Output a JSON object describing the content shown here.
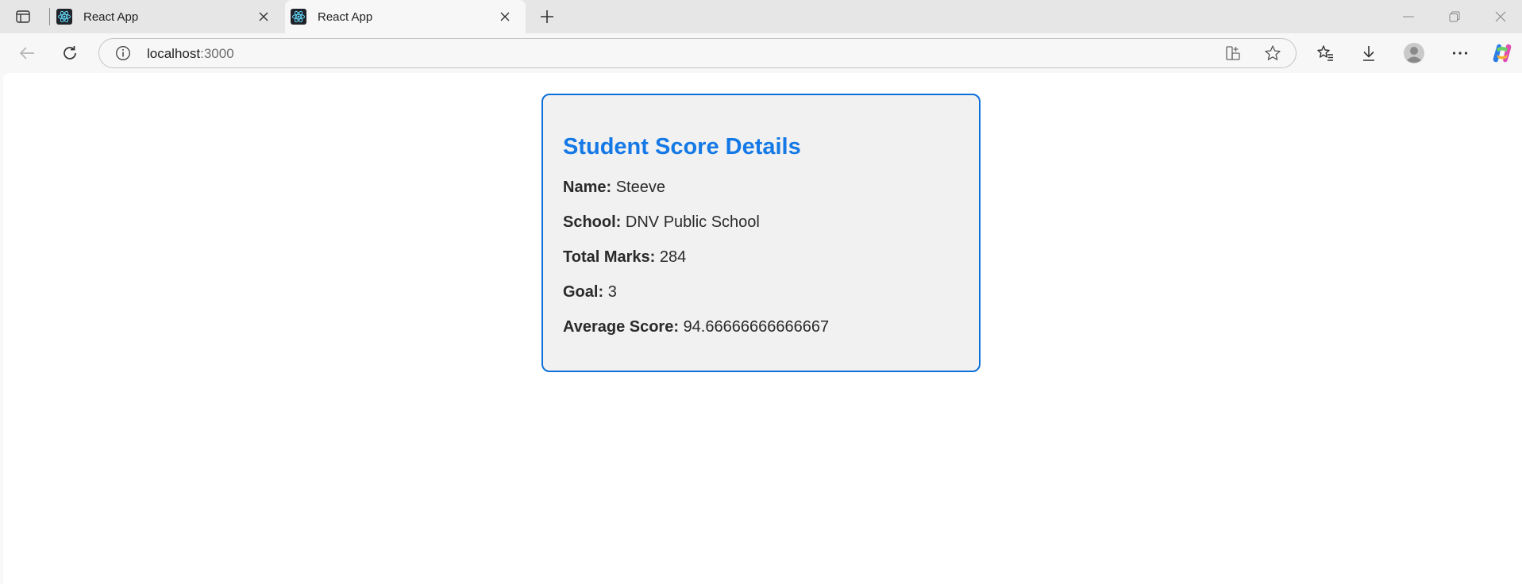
{
  "browser": {
    "tabs": [
      {
        "title": "React App",
        "active": false
      },
      {
        "title": "React App",
        "active": true
      }
    ],
    "address": {
      "host": "localhost",
      "port": ":3000"
    }
  },
  "card": {
    "title": "Student Score Details",
    "border_color": "#0d6fd8",
    "title_color": "#1479e6",
    "fields": [
      {
        "label": "Name:",
        "value": "Steeve"
      },
      {
        "label": "School:",
        "value": "DNV Public School"
      },
      {
        "label": "Total Marks:",
        "value": "284"
      },
      {
        "label": "Goal:",
        "value": "3"
      },
      {
        "label": "Average Score:",
        "value": "94.66666666666667"
      }
    ]
  }
}
